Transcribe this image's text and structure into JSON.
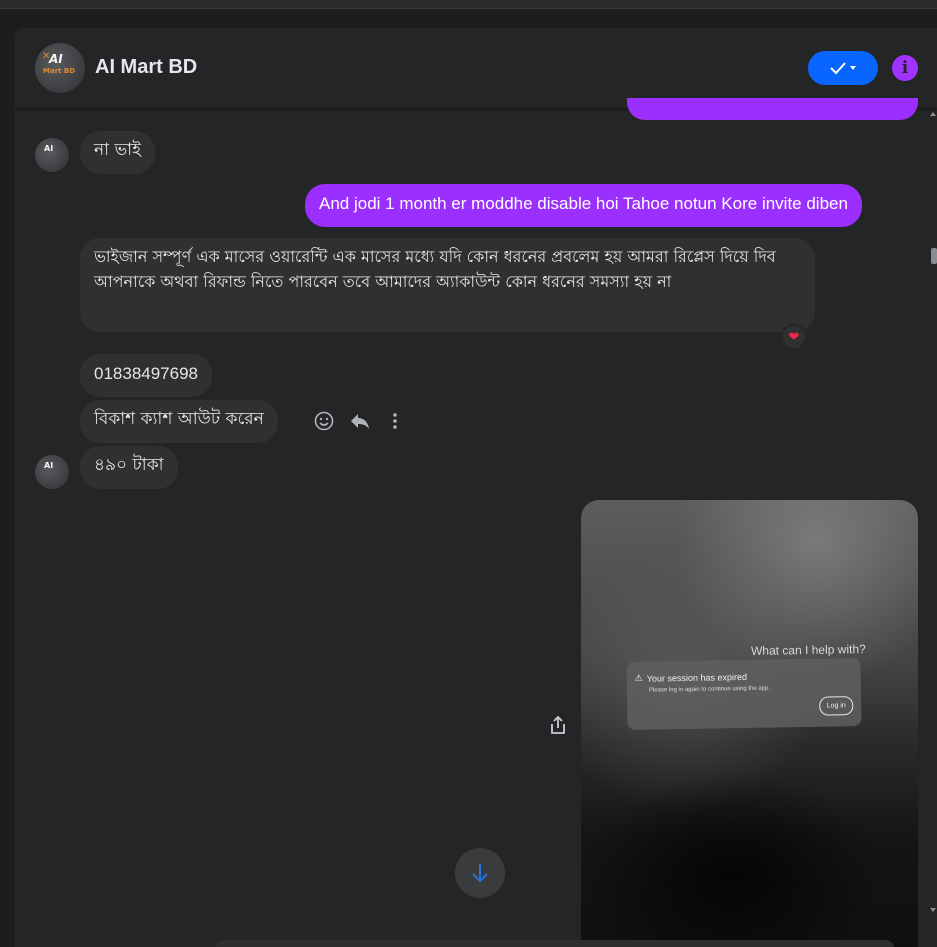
{
  "header": {
    "title": "AI Mart BD",
    "avatar_text_top": "AI",
    "avatar_text_bottom": "Mart BD",
    "check_label": "✓▾",
    "info_label": "i"
  },
  "messages": {
    "m1": "না ভাই",
    "m2": "And jodi 1 month er moddhe disable hoi Tahoe notun Kore invite diben",
    "m3": "ভাইজান সম্পূর্ণ এক মাসের ওয়ারেন্টি এক মাসের মধ্যে যদি কোন ধরনের প্রবলেম হয় আমরা রিপ্লেস দিয়ে দিব আপনাকে অথবা রিফান্ড নিতে পারবেন তবে আমাদের অ্যাকাউন্ট কোন ধরনের সমস্যা হয় না",
    "m3_reaction": "❤",
    "m4": "01838497698",
    "m5": "বিকাশ ক্যাশ আউট করেন",
    "m6": "৪৯০ টাকা"
  },
  "photo": {
    "question": "What can I help with?",
    "session_title": "Your session has expired",
    "session_sub": "Please log in again to continue using the app.",
    "login_label": "Log in"
  },
  "colors": {
    "outgoing": "#9b2ffd",
    "incoming": "#303030",
    "accent_blue": "#0866ff",
    "info": "#a033ff"
  }
}
